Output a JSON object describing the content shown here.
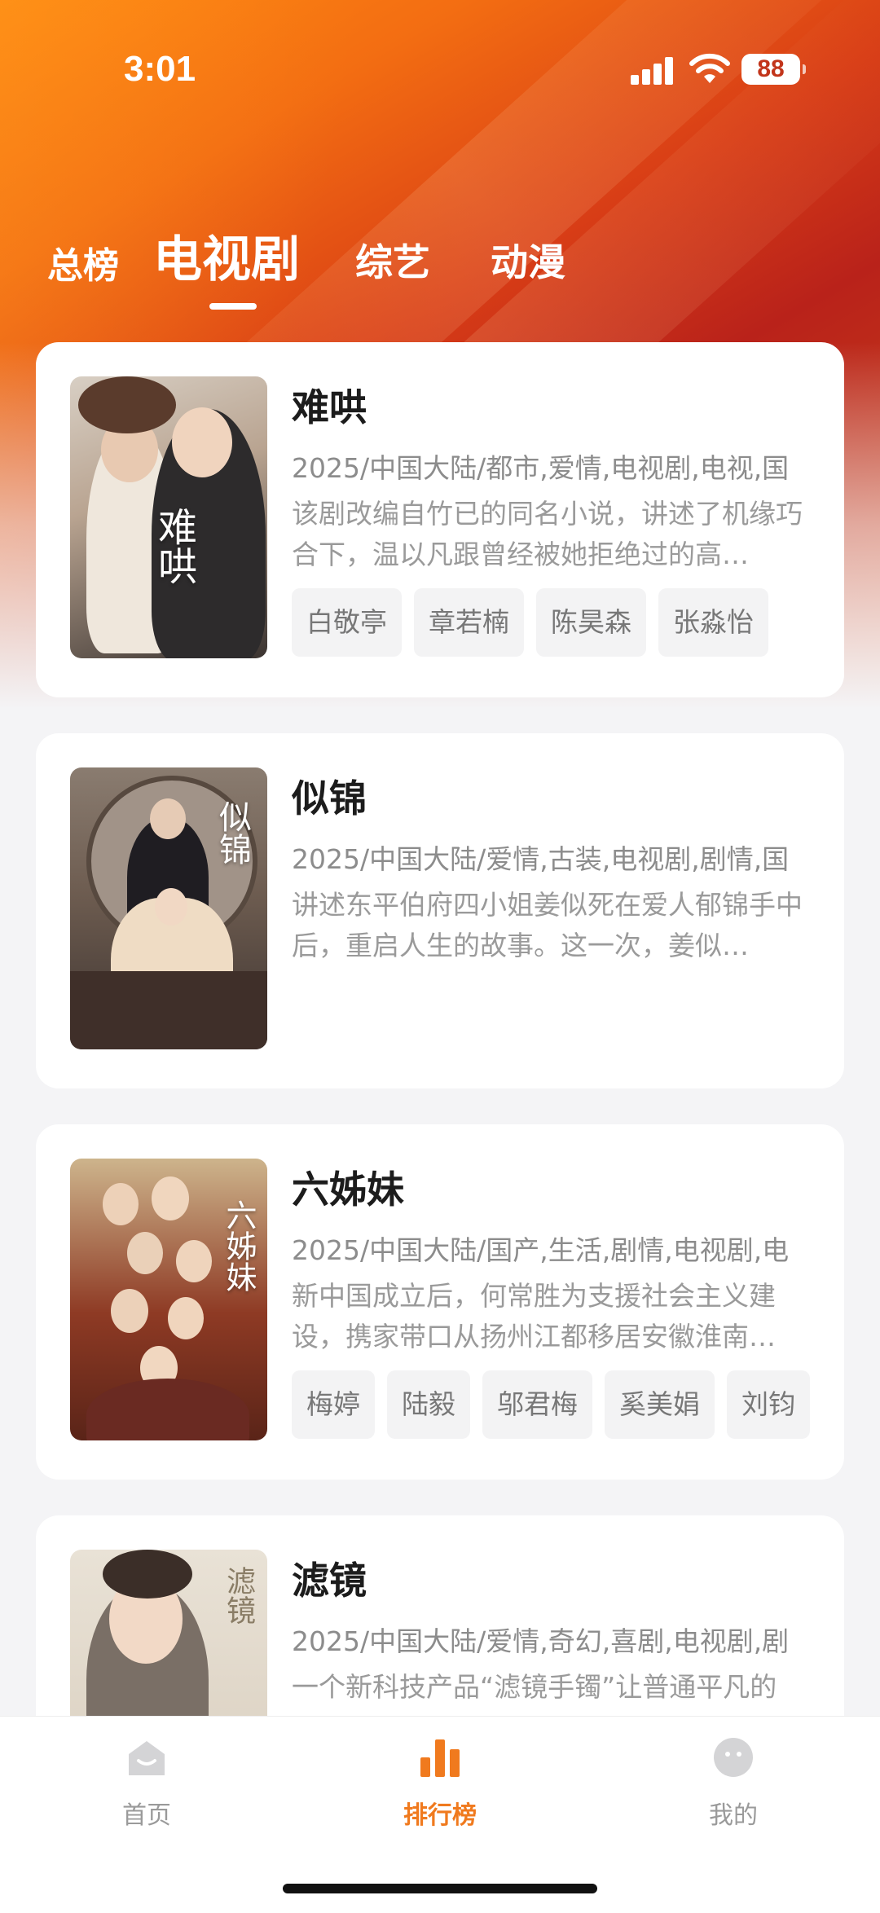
{
  "status_bar": {
    "time": "3:01",
    "battery": "88"
  },
  "tabs": [
    {
      "label": "总榜"
    },
    {
      "label": "电视剧"
    },
    {
      "label": "综艺"
    },
    {
      "label": "动漫"
    }
  ],
  "active_tab": "电视剧",
  "shows": [
    {
      "title": "难哄",
      "meta": "2025/中国大陆/都市,爱情,电视剧,电视,国",
      "description": "该剧改编自竹已的同名小说，讲述了机缘巧合下，温以凡跟曾经被她拒绝过的高…",
      "cast": [
        "白敬亭",
        "章若楠",
        "陈昊森",
        "张淼怡"
      ],
      "poster_calligraphy": "难哄"
    },
    {
      "title": "似锦",
      "meta": "2025/中国大陆/爱情,古装,电视剧,剧情,国",
      "description": "讲述东平伯府四小姐姜似死在爱人郁锦手中后，重启人生的故事。这一次，姜似…",
      "cast": [],
      "poster_calligraphy": "似锦"
    },
    {
      "title": "六姊妹",
      "meta": "2025/中国大陆/国产,生活,剧情,电视剧,电",
      "description": "新中国成立后，何常胜为支援社会主义建设，携家带口从扬州江都移居安徽淮南…",
      "cast": [
        "梅婷",
        "陆毅",
        "邬君梅",
        "奚美娟",
        "刘钧"
      ],
      "poster_calligraphy": "六姊妹"
    },
    {
      "title": "滤镜",
      "meta": "2025/中国大陆/爱情,奇幻,喜剧,电视剧,剧",
      "description": "一个新科技产品“滤镜手镯”让普通平凡的",
      "cast": [],
      "poster_calligraphy": "滤镜"
    }
  ],
  "bottom_nav": [
    {
      "label": "首页",
      "icon": "home-icon"
    },
    {
      "label": "排行榜",
      "icon": "chart-icon"
    },
    {
      "label": "我的",
      "icon": "profile-icon"
    }
  ],
  "colors": {
    "accent": "#f07a1e",
    "header_red": "#c2351b",
    "header_orange": "#ff8a10"
  }
}
